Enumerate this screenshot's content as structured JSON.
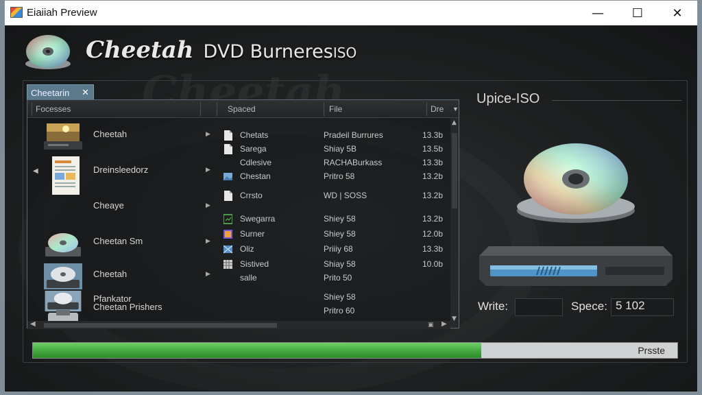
{
  "window": {
    "title": "Eiaiiah Preview",
    "controls": {
      "minimize": "—",
      "maximize": "☐",
      "close": "✕"
    }
  },
  "header": {
    "title_main": "Cheetah",
    "title_mid": "DVD Burneres",
    "title_small": "ISO"
  },
  "tab": {
    "label": "Cheetarin",
    "close": "✕"
  },
  "columns": {
    "processes": "Focesses",
    "spaced": "Spaced",
    "file": "File",
    "size": "Dre"
  },
  "left_items": [
    {
      "label": "Cheetah",
      "icon": "dvd-drive-landscape-icon"
    },
    {
      "label": "Dreinsleedorz",
      "icon": "document-icon"
    },
    {
      "label": "Cheaye",
      "icon": ""
    },
    {
      "label": "Cheetan Sm",
      "icon": "disc-drive-icon"
    },
    {
      "label": "Cheetah",
      "icon": "disc-drive-blue-icon"
    },
    {
      "label": "Pfankator",
      "icon": "disc-drive-blue-icon"
    },
    {
      "label": "Cheetan Prishers",
      "icon": "printer-drive-icon"
    }
  ],
  "files": [
    {
      "name": "Chetats",
      "type": "Pradeil Burrures",
      "size": "13.3b",
      "icon": "file-icon"
    },
    {
      "name": "Sarega",
      "type": "Shiay 5B",
      "size": "13.5b",
      "icon": "file-icon"
    },
    {
      "name": "Cdlesive",
      "type": "RACHABurkass",
      "size": "13.3b",
      "icon": ""
    },
    {
      "name": "Chestan",
      "type": "Pritro 58",
      "size": "13.2b",
      "icon": "image-icon"
    },
    {
      "name": "Crrsto",
      "type": "WD | SOSS",
      "size": "13.2b",
      "icon": "file-icon"
    },
    {
      "name": "Swegarra",
      "type": "Shiey 58",
      "size": "13.2b",
      "icon": "green-file-icon"
    },
    {
      "name": "Surner",
      "type": "Shiey 58",
      "size": "12.0b",
      "icon": "purple-file-icon"
    },
    {
      "name": "Oliz",
      "type": "Priiiy 68",
      "size": "13.3b",
      "icon": "blue-image-icon"
    },
    {
      "name": "Sistived",
      "type": "Shiay 58",
      "size": "10.0b",
      "icon": "grid-file-icon"
    },
    {
      "name": "salle",
      "type": "Prito 50",
      "size": "",
      "icon": ""
    },
    {
      "name": "",
      "type": "Shiey 58",
      "size": "",
      "icon": ""
    },
    {
      "name": "",
      "type": "Pritro 60",
      "size": "",
      "icon": ""
    }
  ],
  "right_panel": {
    "title": "Upice-ISO",
    "write_label": "Write:",
    "write_value": "",
    "space_label": "Spece:",
    "space_value": "5 102"
  },
  "progress": {
    "label": "Prsste",
    "fraction": 0.696
  },
  "colors": {
    "accent": "#5a7a8c",
    "progress_green": "#3ea43a",
    "background": "#1d1f20"
  }
}
